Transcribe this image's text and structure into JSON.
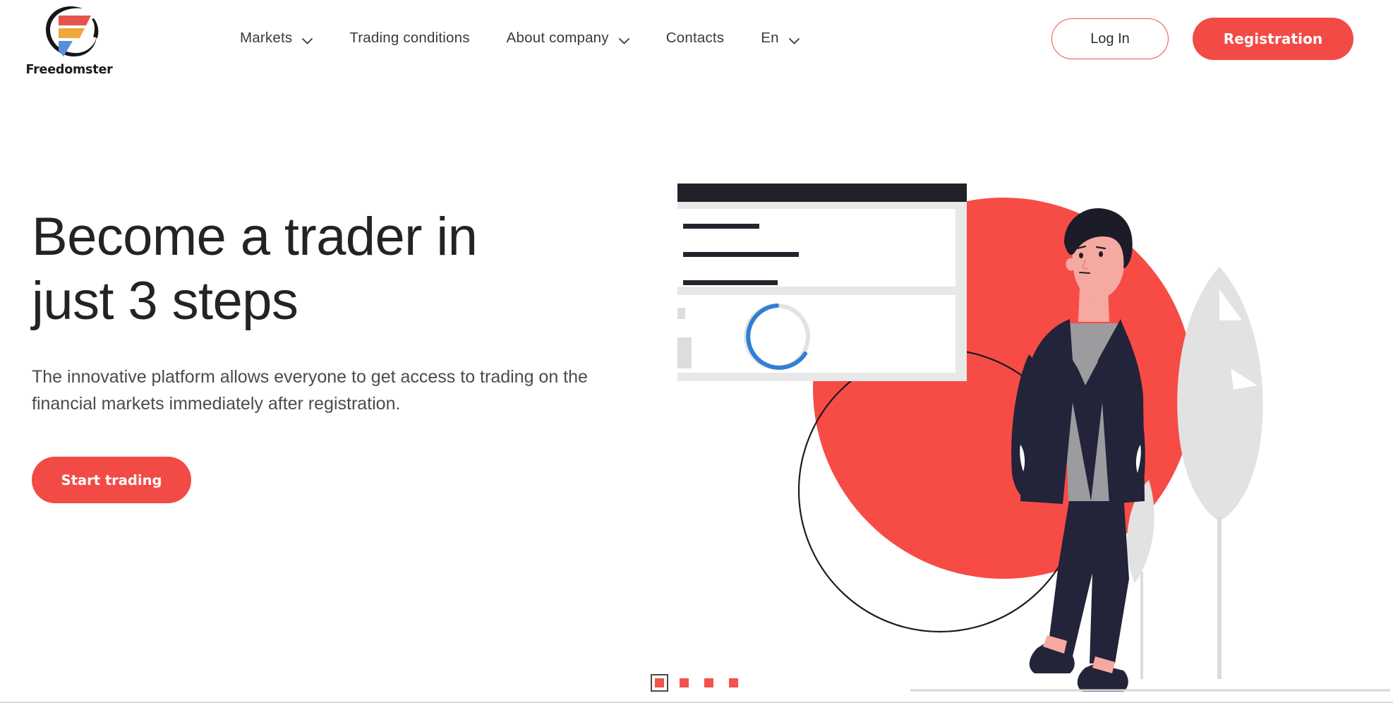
{
  "brand": {
    "name": "Freedomster",
    "logo_icon": "freedomster-logo-icon",
    "colors": {
      "bar_top": "#e4554f",
      "bar_mid": "#efa83d",
      "bar_bottom": "#5a8fd8",
      "arc": "#15151a"
    }
  },
  "nav": {
    "items": [
      {
        "label": "Markets",
        "has_dropdown": true,
        "icon": "chevron-down-icon"
      },
      {
        "label": "Trading conditions",
        "has_dropdown": false,
        "icon": ""
      },
      {
        "label": "About company",
        "has_dropdown": true,
        "icon": "chevron-down-icon"
      },
      {
        "label": "Contacts",
        "has_dropdown": false,
        "icon": ""
      },
      {
        "label": "En",
        "has_dropdown": true,
        "icon": "chevron-down-icon"
      }
    ]
  },
  "auth": {
    "login_label": "Log In",
    "register_label": "Registration"
  },
  "hero": {
    "title_line1": "Become a trader in",
    "title_line2": "just 3 steps",
    "subtitle": "The innovative platform allows everyone to get access to trading on the financial markets immediately after registration.",
    "cta_label": "Start trading"
  },
  "illustration": {
    "card_icon": "browser-card-illustration",
    "checklist_items": 3,
    "check_icon": "check-circle-icon",
    "spinner_icon": "loading-spinner-icon",
    "person_icon": "businessman-illustration",
    "plant_icon": "leaf-plant-icon",
    "circle_icon": "red-circle-shape",
    "outline_circle_icon": "outline-circle-shape"
  },
  "carousel": {
    "slide_count": 4,
    "active_index": 0,
    "labels": [
      "Slide 1",
      "Slide 2",
      "Slide 3",
      "Slide 4"
    ]
  },
  "theme": {
    "accent": "#f24b45",
    "accent_circle": "#f74b45",
    "text_dark": "#232326",
    "text_muted": "#4b4b50",
    "suit_navy": "#23233a",
    "card_dark": "#222028",
    "card_frame": "#e5e5e5",
    "leaf_grey": "#e0e0e0",
    "spinner_blue": "#2f7fd4",
    "skin": "#f6a9a0"
  }
}
